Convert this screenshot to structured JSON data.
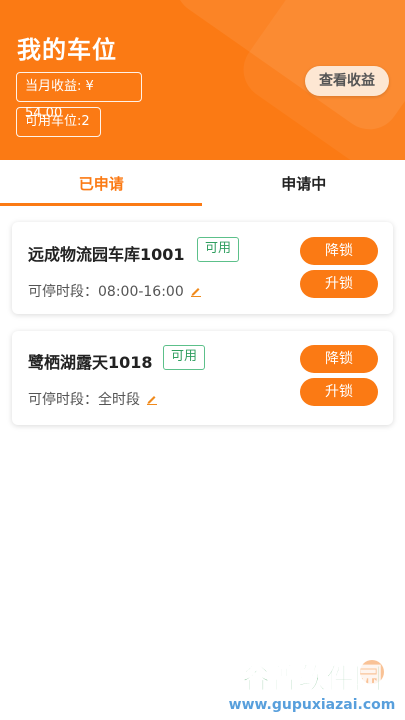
{
  "header": {
    "title": "我的车位",
    "monthly_income": "当月收益: ¥ 54.00",
    "available_spots": "可用车位:2",
    "view_income_label": "查看收益",
    "background_color": "#fb7a14"
  },
  "tabs": [
    {
      "label": "已申请",
      "active": true
    },
    {
      "label": "申请中",
      "active": false
    }
  ],
  "spots": [
    {
      "name": "远成物流园车库1001",
      "status": "可用",
      "hours": "可停时段：08:00-16:00",
      "lower_lock_label": "降锁",
      "raise_lock_label": "升锁"
    },
    {
      "name": "鹭栖湖露天1018",
      "status": "可用",
      "hours": "可停时段：全时段",
      "lower_lock_label": "降锁",
      "raise_lock_label": "升锁"
    }
  ],
  "watermark": {
    "brand": "谷普软件园",
    "url": "www.gupuxiazai.com"
  },
  "icons": {
    "edit": "pencil-icon"
  },
  "colors": {
    "accent": "#fb7a14",
    "status_green": "#2f9e5f"
  }
}
